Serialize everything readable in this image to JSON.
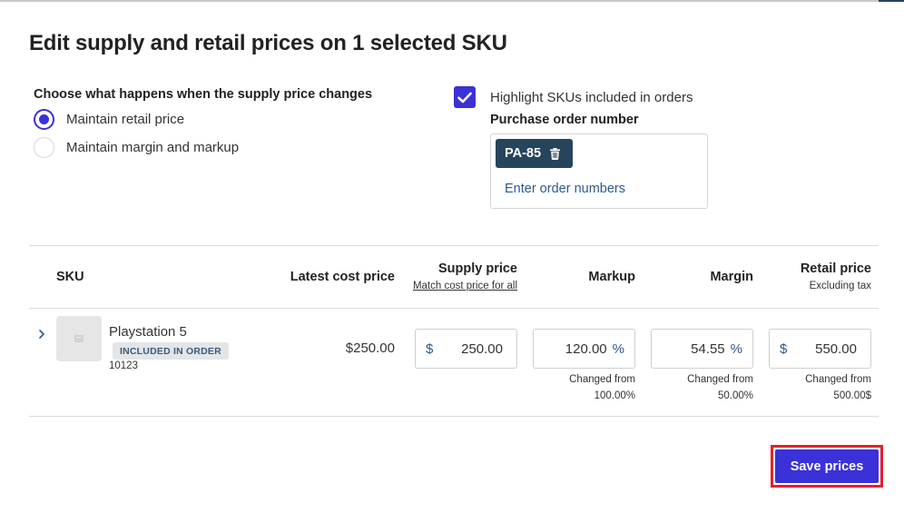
{
  "modal": {
    "title": "Edit supply and retail prices on 1 selected SKU"
  },
  "supply_change": {
    "heading": "Choose what happens when the supply price changes",
    "options": [
      {
        "label": "Maintain retail price",
        "selected": true
      },
      {
        "label": "Maintain margin and markup",
        "selected": false
      }
    ]
  },
  "highlight": {
    "label": "Highlight SKUs included in orders",
    "checked": true
  },
  "purchase_order": {
    "label": "Purchase order number",
    "tags": [
      "PA-85"
    ],
    "placeholder": "Enter order numbers"
  },
  "table": {
    "headers": {
      "sku": "SKU",
      "latest_cost": "Latest cost price",
      "supply": "Supply price",
      "supply_link": "Match cost price for all",
      "markup": "Markup",
      "margin": "Margin",
      "retail": "Retail price",
      "retail_sub": "Excluding tax"
    },
    "rows": [
      {
        "name": "Playstation 5",
        "badge": "INCLUDED IN ORDER",
        "code": "10123",
        "latest_cost": "$250.00",
        "supply": {
          "prefix": "$",
          "value": "250.00"
        },
        "markup": {
          "value": "120.00",
          "suffix": "%",
          "changed_label": "Changed from",
          "changed_value": "100.00%"
        },
        "margin": {
          "value": "54.55",
          "suffix": "%",
          "changed_label": "Changed from",
          "changed_value": "50.00%"
        },
        "retail": {
          "prefix": "$",
          "value": "550.00",
          "changed_label": "Changed from",
          "changed_value": "500.00$"
        }
      }
    ]
  },
  "actions": {
    "save_label": "Save prices"
  },
  "colors": {
    "accent": "#3a31d8",
    "tag_bg": "#27445d",
    "highlight_outline": "#e5202e"
  }
}
